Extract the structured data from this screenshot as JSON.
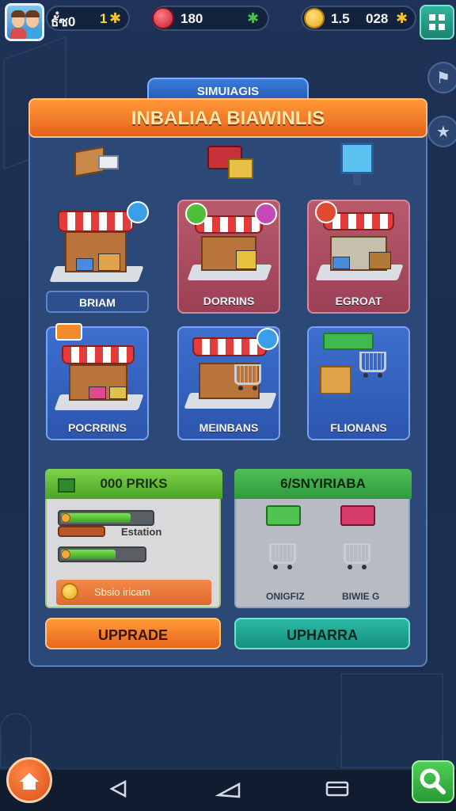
{
  "hud": {
    "stat1": "ธั๋ซ0",
    "stat1_extra": "1",
    "gems": "180",
    "coins": "1.5",
    "stat4": "028"
  },
  "panel": {
    "tab_label": "SIMUIAGIS",
    "title": "INBALIAA BIAWINLIS"
  },
  "shops": [
    {
      "label": "BRIAM"
    },
    {
      "label": "DORRINS"
    },
    {
      "label": "EGROAT"
    },
    {
      "label": "POCRRINS"
    },
    {
      "label": "MEINBANS"
    },
    {
      "label": "FLIONANS"
    }
  ],
  "left_box": {
    "title": "000 PRIKS",
    "bar_label": "Estation",
    "strip_text": "Sbsio iricam",
    "bar1_level": 0.78,
    "bar2_level": 0.68
  },
  "right_box": {
    "title": "6/SNYIRIABA",
    "items": [
      {
        "label": "ONIGFIZ"
      },
      {
        "label": "BIWIE G"
      }
    ]
  },
  "buttons": {
    "upgrade_left": "UPPRADE",
    "upgrade_right": "UPHARRA"
  },
  "icons": {
    "gem": "gem-icon",
    "coin": "coin-icon",
    "puzzle": "puzzle-icon",
    "menu": "grid-menu-icon",
    "star": "star-icon",
    "back": "back-triangle-icon",
    "home": "home-icon",
    "recents": "recents-icon",
    "search": "magnifier-icon"
  },
  "colors": {
    "accent_orange": "#e8661c",
    "accent_teal": "#14907e",
    "panel_blue": "#2c4877",
    "card_red": "#9c4056",
    "card_blue": "#2c56ad"
  }
}
